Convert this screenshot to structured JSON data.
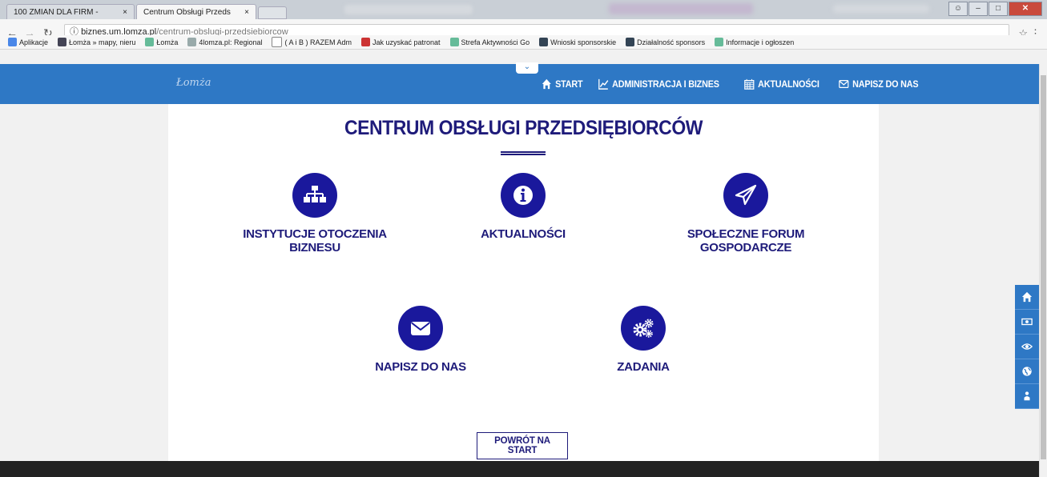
{
  "browser": {
    "tabs": [
      {
        "title": "100 ZMIAN DLA FIRM - ",
        "active": false
      },
      {
        "title": "Centrum Obsługi Przeds",
        "active": true
      }
    ],
    "tab_close": "×",
    "url_host": "biznes.um.lomza.pl",
    "url_path": "/centrum-obslugi-przedsiebiorcow",
    "bookmarks": [
      "Aplikacje",
      "Łomża » mapy, nieru",
      "Łomża",
      "4lomza.pl: Regional",
      "( A i B ) RAZEM Adm",
      "Jak uzyskać patronat",
      "Strefa Aktywności Go",
      "Wnioski sponsorskie",
      "Działalność sponsors",
      "Informacje i ogłoszen"
    ]
  },
  "site": {
    "logo_text": "Łomża",
    "nav": [
      {
        "label": "START",
        "icon": "home-icon"
      },
      {
        "label": "ADMINISTRACJA I BIZNES",
        "icon": "chart-line-icon"
      },
      {
        "label": "AKTUALNOŚCI",
        "icon": "calendar-icon"
      },
      {
        "label": "NAPISZ DO NAS",
        "icon": "envelope-icon"
      }
    ]
  },
  "main": {
    "title": "CENTRUM OBSŁUGI PRZEDSIĘBIORCÓW",
    "features": [
      {
        "label": "INSTYTUCJE OTOCZENIA BIZNESU",
        "icon": "sitemap-icon"
      },
      {
        "label": "AKTUALNOŚCI",
        "icon": "info-icon"
      },
      {
        "label": "SPOŁECZNE FORUM GOSPODARCZE",
        "icon": "paper-plane-icon"
      },
      {
        "label": "NAPISZ DO NAS",
        "icon": "envelope-icon"
      },
      {
        "label": "ZADANIA",
        "icon": "gears-icon"
      }
    ],
    "back_button": "POWRÓT NA START"
  },
  "side_toolbar": [
    "home-icon",
    "money-icon",
    "eye-icon",
    "globe-icon",
    "sitemap-icon"
  ],
  "colors": {
    "header_blue": "#2e78c5",
    "navy": "#1e1b7a",
    "icon_circle": "#1a189c"
  }
}
